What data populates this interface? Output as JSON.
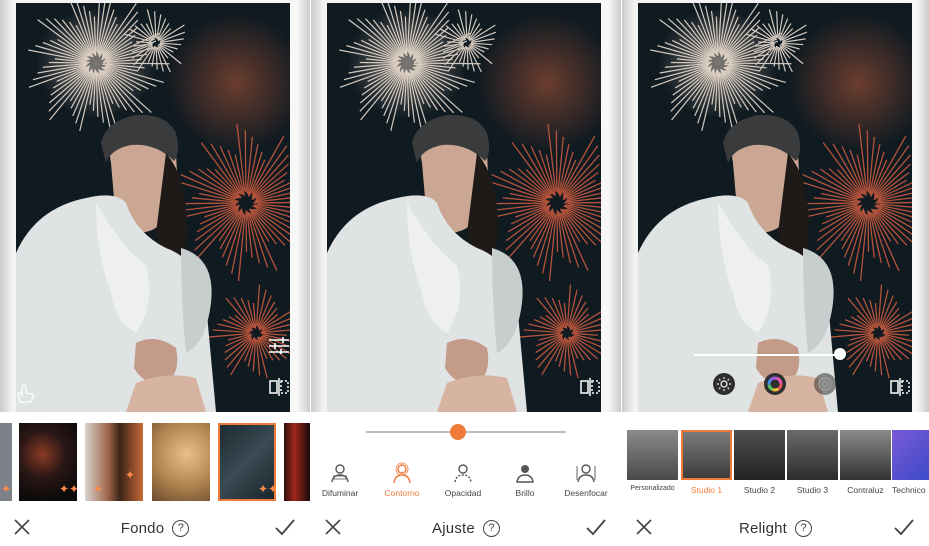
{
  "panels": [
    {
      "title": "Fondo",
      "thumbnails": [
        "city-night",
        "dark-street",
        "sparkle-crowd",
        "gold-glitter",
        "fireworks-selected",
        "dark-edge"
      ]
    },
    {
      "title": "Ajuste",
      "slider_value_percent": 46,
      "tools": [
        {
          "label": "Difuminar",
          "icon": "person-blur-icon"
        },
        {
          "label": "Contorno",
          "icon": "person-outline-icon",
          "active": true
        },
        {
          "label": "Opacidad",
          "icon": "person-opacity-icon"
        },
        {
          "label": "Brillo",
          "icon": "person-brightness-icon"
        },
        {
          "label": "Desenfocar",
          "icon": "person-defocus-icon"
        }
      ]
    },
    {
      "title": "Relight",
      "light_level_percent": 97,
      "presets": [
        {
          "label": "Personalizado"
        },
        {
          "label": "Studio 1",
          "selected": true
        },
        {
          "label": "Studio 2"
        },
        {
          "label": "Studio 3"
        },
        {
          "label": "Contraluz"
        },
        {
          "label": "Technico"
        }
      ]
    }
  ],
  "help_symbol": "?",
  "colors": {
    "accent": "#f07a3a",
    "text": "#333333",
    "sky": "#101b22"
  }
}
